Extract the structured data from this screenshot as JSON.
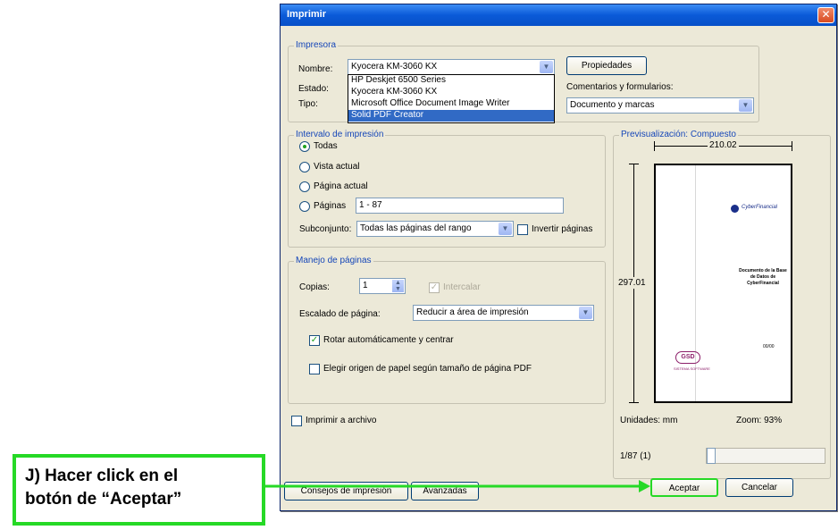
{
  "window": {
    "title": "Imprimir"
  },
  "printer_group": {
    "legend": "Impresora",
    "name_label": "Nombre:",
    "state_label": "Estado:",
    "type_label": "Tipo:",
    "selected_printer": "Kyocera KM-3060 KX",
    "options": [
      "HP Deskjet 6500 Series",
      "Kyocera KM-3060 KX",
      "Microsoft Office Document Image Writer",
      "Solid PDF Creator"
    ],
    "highlighted_option": "Solid PDF Creator",
    "properties_button": "Propiedades",
    "comments_label": "Comentarios y formularios:",
    "comments_value": "Documento y marcas"
  },
  "range_group": {
    "legend": "Intervalo de impresión",
    "all_label": "Todas",
    "current_view_label": "Vista actual",
    "current_page_label": "Página actual",
    "pages_label": "Páginas",
    "pages_value": "1 - 87",
    "subset_label": "Subconjunto:",
    "subset_value": "Todas las páginas del rango",
    "reverse_label": "Invertir páginas"
  },
  "handling_group": {
    "legend": "Manejo de páginas",
    "copies_label": "Copias:",
    "copies_value": "1",
    "collate_label": "Intercalar",
    "scaling_label": "Escalado de página:",
    "scaling_value": "Reducir a área de impresión",
    "auto_rotate_label": "Rotar automáticamente y centrar",
    "paper_source_label": "Elegir origen de papel según tamaño de página PDF"
  },
  "print_to_file_label": "Imprimir a archivo",
  "preview": {
    "legend": "Previsualización: Compuesto",
    "width_value": "210.02",
    "height_value": "297.01",
    "units_label": "Unidades: mm",
    "zoom_label": "Zoom: 93%",
    "page_counter": "1/87 (1)",
    "doc_logo_text": "CyberFinancial",
    "doc_title": "Documento de la Base de Datos de CyberFinancial",
    "doc_footer_logo": "GSD",
    "doc_footer_caption": "SISTEMA SOFTWARE",
    "doc_date": "00/00"
  },
  "buttons": {
    "tips": "Consejos de impresión",
    "advanced": "Avanzadas",
    "accept": "Aceptar",
    "cancel": "Cancelar"
  },
  "annotation": {
    "line1": "J) Hacer click en el",
    "line2": "botón de “Aceptar”",
    "color": "#26d926"
  }
}
